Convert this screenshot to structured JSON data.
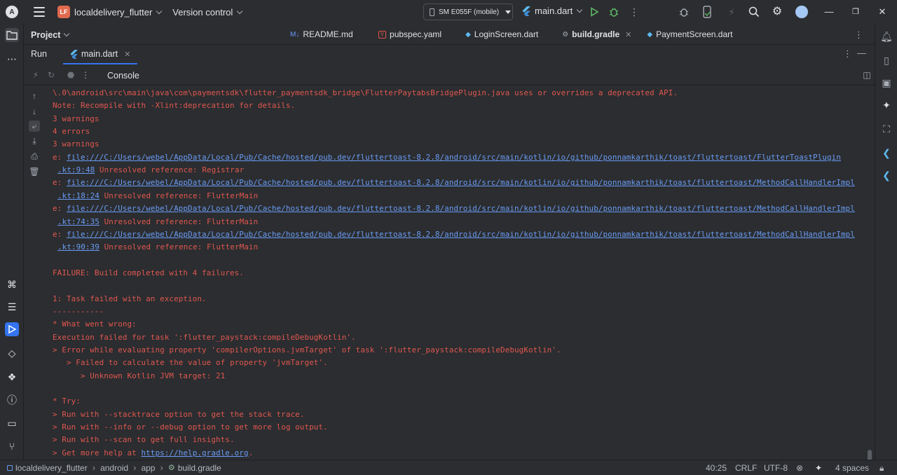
{
  "titlebar": {
    "project_badge": "LF",
    "project_name": "localdelivery_flutter",
    "vcs_label": "Version control",
    "device": "SM E055F (mobile)",
    "run_config": "main.dart"
  },
  "project_header": {
    "label": "Project",
    "tabs": [
      {
        "icon": "M↓",
        "label": "README.md"
      },
      {
        "icon": "Y",
        "label": "pubspec.yaml"
      },
      {
        "icon": "◆",
        "label": "LoginScreen.dart"
      },
      {
        "icon": "⚙",
        "label": "build.gradle"
      },
      {
        "icon": "◆",
        "label": "PaymentScreen.dart"
      }
    ]
  },
  "run_panel": {
    "label": "Run",
    "tab_label": "main.dart",
    "console_label": "Console"
  },
  "console": {
    "lines": [
      {
        "text": "\\.0\\android\\src\\main\\java\\com\\paymentsdk\\flutter_paymentsdk_bridge\\FlutterPaytabsBridgePlugin.java uses or overrides a deprecated API."
      },
      {
        "text": "Note: Recompile with -Xlint:deprecation for details."
      },
      {
        "text": "3 warnings"
      },
      {
        "text": "4 errors"
      },
      {
        "text": "3 warnings"
      },
      {
        "prefix": "e: ",
        "link": "file:///C:/Users/webel/AppData/Local/Pub/Cache/hosted/pub.dev/fluttertoast-8.2.8/android/src/main/kotlin/io/github/ponnamkarthik/toast/fluttertoast/FlutterToastPlugin"
      },
      {
        "link": ".kt:9:48",
        "suffix": " Unresolved reference: Registrar",
        "indent": true
      },
      {
        "prefix": "e: ",
        "link": "file:///C:/Users/webel/AppData/Local/Pub/Cache/hosted/pub.dev/fluttertoast-8.2.8/android/src/main/kotlin/io/github/ponnamkarthik/toast/fluttertoast/MethodCallHandlerImpl"
      },
      {
        "link": ".kt:18:24",
        "suffix": " Unresolved reference: FlutterMain",
        "indent": true
      },
      {
        "prefix": "e: ",
        "link": "file:///C:/Users/webel/AppData/Local/Pub/Cache/hosted/pub.dev/fluttertoast-8.2.8/android/src/main/kotlin/io/github/ponnamkarthik/toast/fluttertoast/MethodCallHandlerImpl"
      },
      {
        "link": ".kt:74:35",
        "suffix": " Unresolved reference: FlutterMain",
        "indent": true
      },
      {
        "prefix": "e: ",
        "link": "file:///C:/Users/webel/AppData/Local/Pub/Cache/hosted/pub.dev/fluttertoast-8.2.8/android/src/main/kotlin/io/github/ponnamkarthik/toast/fluttertoast/MethodCallHandlerImpl"
      },
      {
        "link": ".kt:90:39",
        "suffix": " Unresolved reference: FlutterMain",
        "indent": true
      },
      {
        "text": ""
      },
      {
        "text": "FAILURE: Build completed with 4 failures."
      },
      {
        "text": ""
      },
      {
        "text": "1: Task failed with an exception."
      },
      {
        "text": "-----------"
      },
      {
        "text": "* What went wrong:"
      },
      {
        "text": "Execution failed for task ':flutter_paystack:compileDebugKotlin'."
      },
      {
        "text": "> Error while evaluating property 'compilerOptions.jvmTarget' of task ':flutter_paystack:compileDebugKotlin'."
      },
      {
        "text": "   > Failed to calculate the value of property 'jvmTarget'."
      },
      {
        "text": "      > Unknown Kotlin JVM target: 21"
      },
      {
        "text": ""
      },
      {
        "text": "* Try:"
      },
      {
        "text": "> Run with --stacktrace option to get the stack trace."
      },
      {
        "text": "> Run with --info or --debug option to get more log output."
      },
      {
        "text": "> Run with --scan to get full insights."
      },
      {
        "prefix": "> Get more help at ",
        "link": "https://help.gradle.org",
        "suffix": "."
      }
    ]
  },
  "statusbar": {
    "breadcrumbs": [
      "localdelivery_flutter",
      "android",
      "app",
      "build.gradle"
    ],
    "position": "40:25",
    "line_separator": "CRLF",
    "encoding": "UTF-8",
    "indent": "4 spaces"
  },
  "colors": {
    "error_text": "#e0574f",
    "link": "#6a9bf4",
    "accent": "#3574f0"
  }
}
